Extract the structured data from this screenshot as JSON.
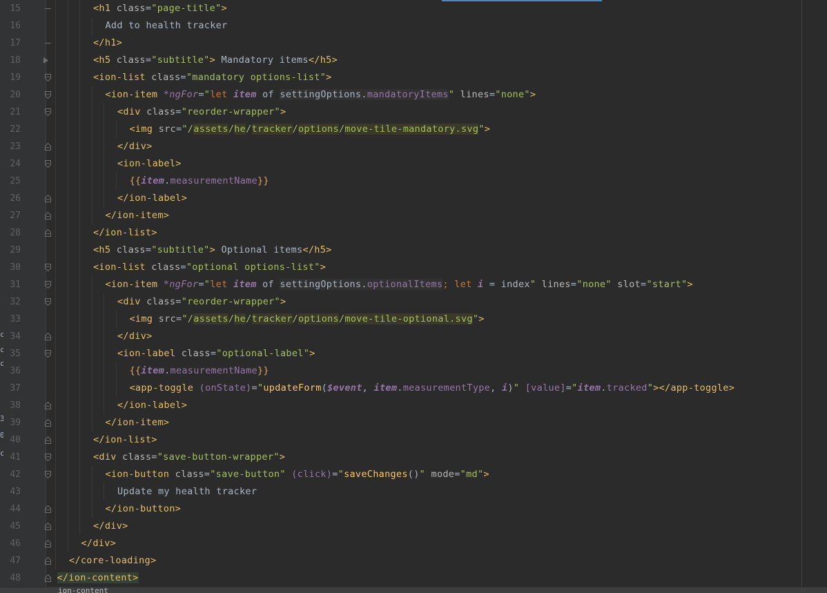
{
  "editor": {
    "language": "html",
    "status_breadcrumb": "ion-content",
    "colors": {
      "background": "#2b2b2b",
      "gutter": "#313335",
      "tag": "#e8bf6a",
      "attribute": "#bababa",
      "string": "#a5c25c",
      "variable": "#9876aa",
      "accent": "#4a88c7"
    },
    "lines": [
      {
        "num": "15",
        "indent": 0,
        "fold": "dash",
        "tokens": [
          [
            "tag",
            "<h1 "
          ],
          [
            "attr",
            "class"
          ],
          [
            "pl",
            "="
          ],
          [
            "str",
            "\"page-title\""
          ],
          [
            "tag",
            ">"
          ]
        ]
      },
      {
        "num": "16",
        "indent": 1,
        "fold": "",
        "tokens": [
          [
            "text",
            "Add to health tracker"
          ]
        ]
      },
      {
        "num": "17",
        "indent": 0,
        "fold": "dash",
        "tokens": [
          [
            "tag",
            "</h1>"
          ]
        ]
      },
      {
        "num": "18",
        "indent": 0,
        "fold": "arrow",
        "tokens": [
          [
            "tag",
            "<h5 "
          ],
          [
            "attr",
            "class"
          ],
          [
            "pl",
            "="
          ],
          [
            "str",
            "\"subtitle\""
          ],
          [
            "tag",
            ">"
          ],
          [
            "text",
            " Mandatory items"
          ],
          [
            "tag",
            "</h5>"
          ]
        ]
      },
      {
        "num": "19",
        "indent": 0,
        "fold": "open",
        "tokens": [
          [
            "tag",
            "<ion-list "
          ],
          [
            "attr",
            "class"
          ],
          [
            "pl",
            "="
          ],
          [
            "str",
            "\"mandatory options-list\""
          ],
          [
            "tag",
            ">"
          ]
        ]
      },
      {
        "num": "20",
        "indent": 1,
        "fold": "open",
        "tokens": [
          [
            "tag",
            "<ion-item "
          ],
          [
            "ital",
            "*ngFor"
          ],
          [
            "pl",
            "="
          ],
          [
            "str",
            "\""
          ],
          [
            "ng",
            "let "
          ],
          [
            "var",
            "item"
          ],
          [
            "pl",
            " of "
          ],
          [
            "hl",
            "settingOptions."
          ],
          [
            "hlprop",
            "mandatoryItems"
          ],
          [
            "str",
            "\""
          ],
          [
            "attr",
            " lines"
          ],
          [
            "pl",
            "="
          ],
          [
            "str",
            "\"none\""
          ],
          [
            "tag",
            ">"
          ]
        ]
      },
      {
        "num": "21",
        "indent": 2,
        "fold": "open",
        "tokens": [
          [
            "tag",
            "<div "
          ],
          [
            "attr",
            "class"
          ],
          [
            "pl",
            "="
          ],
          [
            "str",
            "\"reorder-wrapper\""
          ],
          [
            "tag",
            ">"
          ]
        ]
      },
      {
        "num": "22",
        "indent": 3,
        "fold": "",
        "tokens": [
          [
            "tag",
            "<img "
          ],
          [
            "attr",
            "src"
          ],
          [
            "pl",
            "="
          ],
          [
            "str",
            "\"/"
          ],
          [
            "path",
            "assets"
          ],
          [
            "str",
            "/"
          ],
          [
            "path",
            "he"
          ],
          [
            "str",
            "/"
          ],
          [
            "path",
            "tracker"
          ],
          [
            "str",
            "/"
          ],
          [
            "path",
            "options"
          ],
          [
            "str",
            "/"
          ],
          [
            "path",
            "move-tile-mandatory.svg"
          ],
          [
            "str",
            "\""
          ],
          [
            "tag",
            ">"
          ]
        ]
      },
      {
        "num": "23",
        "indent": 2,
        "fold": "close",
        "tokens": [
          [
            "tag",
            "</div>"
          ]
        ]
      },
      {
        "num": "24",
        "indent": 2,
        "fold": "open",
        "tokens": [
          [
            "tag",
            "<ion-label>"
          ]
        ]
      },
      {
        "num": "25",
        "indent": 3,
        "fold": "",
        "tokens": [
          [
            "brace",
            "{{"
          ],
          [
            "var",
            "item"
          ],
          [
            "pl",
            "."
          ],
          [
            "prop",
            "measurementName"
          ],
          [
            "brace",
            "}}"
          ]
        ]
      },
      {
        "num": "26",
        "indent": 2,
        "fold": "close",
        "tokens": [
          [
            "tag",
            "</ion-label>"
          ]
        ]
      },
      {
        "num": "27",
        "indent": 1,
        "fold": "close",
        "tokens": [
          [
            "tag",
            "</ion-item>"
          ]
        ]
      },
      {
        "num": "28",
        "indent": 0,
        "fold": "close",
        "tokens": [
          [
            "tag",
            "</ion-list>"
          ]
        ]
      },
      {
        "num": "29",
        "indent": 0,
        "fold": "",
        "tokens": [
          [
            "tag",
            "<h5 "
          ],
          [
            "attr",
            "class"
          ],
          [
            "pl",
            "="
          ],
          [
            "str",
            "\"subtitle\""
          ],
          [
            "tag",
            ">"
          ],
          [
            "text",
            " Optional items"
          ],
          [
            "tag",
            "</h5>"
          ]
        ]
      },
      {
        "num": "30",
        "indent": 0,
        "fold": "open",
        "tokens": [
          [
            "tag",
            "<ion-list "
          ],
          [
            "attr",
            "class"
          ],
          [
            "pl",
            "="
          ],
          [
            "str",
            "\"optional options-list\""
          ],
          [
            "tag",
            ">"
          ]
        ]
      },
      {
        "num": "31",
        "indent": 1,
        "fold": "open",
        "tokens": [
          [
            "tag",
            "<ion-item "
          ],
          [
            "ital",
            "*ngFor"
          ],
          [
            "pl",
            "="
          ],
          [
            "str",
            "\""
          ],
          [
            "ng",
            "let "
          ],
          [
            "var",
            "item"
          ],
          [
            "pl",
            " of "
          ],
          [
            "hl",
            "settingOptions."
          ],
          [
            "hlprop",
            "optionalItems"
          ],
          [
            "ng",
            "; let "
          ],
          [
            "var",
            "i"
          ],
          [
            "pl",
            " = index"
          ],
          [
            "str",
            "\""
          ],
          [
            "attr",
            " lines"
          ],
          [
            "pl",
            "="
          ],
          [
            "str",
            "\"none\""
          ],
          [
            "attr",
            " slot"
          ],
          [
            "pl",
            "="
          ],
          [
            "str",
            "\"start\""
          ],
          [
            "tag",
            ">"
          ]
        ]
      },
      {
        "num": "32",
        "indent": 2,
        "fold": "open",
        "tokens": [
          [
            "tag",
            "<div "
          ],
          [
            "attr",
            "class"
          ],
          [
            "pl",
            "="
          ],
          [
            "str",
            "\"reorder-wrapper\""
          ],
          [
            "tag",
            ">"
          ]
        ]
      },
      {
        "num": "33",
        "indent": 3,
        "fold": "",
        "tokens": [
          [
            "tag",
            "<img "
          ],
          [
            "attr",
            "src"
          ],
          [
            "pl",
            "="
          ],
          [
            "str",
            "\"/"
          ],
          [
            "path",
            "assets"
          ],
          [
            "str",
            "/"
          ],
          [
            "path",
            "he"
          ],
          [
            "str",
            "/"
          ],
          [
            "path",
            "tracker"
          ],
          [
            "str",
            "/"
          ],
          [
            "path",
            "options"
          ],
          [
            "str",
            "/"
          ],
          [
            "path",
            "move-tile-optional.svg"
          ],
          [
            "str",
            "\""
          ],
          [
            "tag",
            ">"
          ]
        ]
      },
      {
        "num": "34",
        "indent": 2,
        "fold": "close",
        "tokens": [
          [
            "tag",
            "</div>"
          ]
        ]
      },
      {
        "num": "35",
        "indent": 2,
        "fold": "open",
        "tokens": [
          [
            "tag",
            "<ion-label "
          ],
          [
            "attr",
            "class"
          ],
          [
            "pl",
            "="
          ],
          [
            "str",
            "\"optional-label\""
          ],
          [
            "tag",
            ">"
          ]
        ]
      },
      {
        "num": "36",
        "indent": 3,
        "fold": "",
        "tokens": [
          [
            "brace",
            "{{"
          ],
          [
            "var",
            "item"
          ],
          [
            "pl",
            "."
          ],
          [
            "prop",
            "measurementName"
          ],
          [
            "brace",
            "}}"
          ]
        ]
      },
      {
        "num": "37",
        "indent": 3,
        "fold": "",
        "tokens": [
          [
            "tag",
            "<app-toggle "
          ],
          [
            "bind",
            "(onState)"
          ],
          [
            "pl",
            "="
          ],
          [
            "str",
            "\""
          ],
          [
            "fn",
            "updateForm"
          ],
          [
            "pl",
            "("
          ],
          [
            "var",
            "$event"
          ],
          [
            "pl",
            ", "
          ],
          [
            "var",
            "item"
          ],
          [
            "pl",
            "."
          ],
          [
            "prop",
            "measurementType"
          ],
          [
            "pl",
            ", "
          ],
          [
            "var",
            "i"
          ],
          [
            "pl",
            ")"
          ],
          [
            "str",
            "\""
          ],
          [
            "bind",
            " [value]"
          ],
          [
            "pl",
            "="
          ],
          [
            "str",
            "\""
          ],
          [
            "var",
            "item"
          ],
          [
            "pl",
            "."
          ],
          [
            "prop",
            "tracked"
          ],
          [
            "str",
            "\""
          ],
          [
            "tag",
            "></app-toggle>"
          ]
        ]
      },
      {
        "num": "38",
        "indent": 2,
        "fold": "close",
        "tokens": [
          [
            "tag",
            "</ion-label>"
          ]
        ]
      },
      {
        "num": "39",
        "indent": 1,
        "fold": "close",
        "tokens": [
          [
            "tag",
            "</ion-item>"
          ]
        ]
      },
      {
        "num": "40",
        "indent": 0,
        "fold": "close",
        "tokens": [
          [
            "tag",
            "</ion-list>"
          ]
        ]
      },
      {
        "num": "41",
        "indent": 0,
        "fold": "open",
        "tokens": [
          [
            "tag",
            "<div "
          ],
          [
            "attr",
            "class"
          ],
          [
            "pl",
            "="
          ],
          [
            "str",
            "\"save-button-wrapper\""
          ],
          [
            "tag",
            ">"
          ]
        ]
      },
      {
        "num": "42",
        "indent": 1,
        "fold": "open",
        "tokens": [
          [
            "tag",
            "<ion-button "
          ],
          [
            "attr",
            "class"
          ],
          [
            "pl",
            "="
          ],
          [
            "str",
            "\"save-button\""
          ],
          [
            "bind",
            " (click)"
          ],
          [
            "pl",
            "="
          ],
          [
            "str",
            "\""
          ],
          [
            "fn",
            "saveChanges"
          ],
          [
            "pl",
            "()"
          ],
          [
            "str",
            "\""
          ],
          [
            "attr",
            " mode"
          ],
          [
            "pl",
            "="
          ],
          [
            "str",
            "\"md\""
          ],
          [
            "tag",
            ">"
          ]
        ]
      },
      {
        "num": "43",
        "indent": 2,
        "fold": "",
        "tokens": [
          [
            "text",
            "Update my health tracker"
          ]
        ]
      },
      {
        "num": "44",
        "indent": 1,
        "fold": "close",
        "tokens": [
          [
            "tag",
            "</ion-button>"
          ]
        ]
      },
      {
        "num": "45",
        "indent": 0,
        "fold": "close",
        "tokens": [
          [
            "tag",
            "</div>"
          ]
        ]
      },
      {
        "num": "46",
        "indent": -1,
        "fold": "close",
        "tokens": [
          [
            "tag",
            "</div>"
          ]
        ]
      },
      {
        "num": "47",
        "indent": -2,
        "fold": "close",
        "tokens": [
          [
            "tag",
            "</core-loading>"
          ]
        ]
      },
      {
        "num": "48",
        "indent": -3,
        "fold": "close",
        "tokens": [
          [
            "seltag",
            "</ion-content>"
          ]
        ]
      }
    ]
  }
}
